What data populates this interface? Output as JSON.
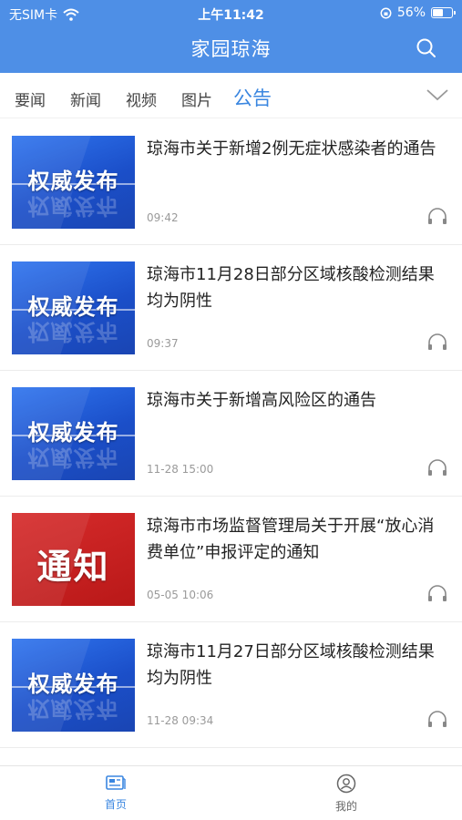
{
  "status_bar": {
    "carrier": "无SIM卡",
    "time": "上午11:42",
    "battery": "56%",
    "battery_level": 0.56
  },
  "header": {
    "title": "家园琼海"
  },
  "tabs": [
    {
      "label": "要闻"
    },
    {
      "label": "新闻"
    },
    {
      "label": "视频"
    },
    {
      "label": "图片"
    },
    {
      "label": "公告",
      "active": true
    }
  ],
  "articles": [
    {
      "title": "琼海市关于新增2例无症状感染者的通告",
      "time": "09:42",
      "thumb_text": "权威发布",
      "thumb_color": "blue"
    },
    {
      "title": "琼海市11月28日部分区域核酸检测结果均为阴性",
      "time": "09:37",
      "thumb_text": "权威发布",
      "thumb_color": "blue"
    },
    {
      "title": "琼海市关于新增高风险区的通告",
      "time": "11-28 15:00",
      "thumb_text": "权威发布",
      "thumb_color": "blue"
    },
    {
      "title": "琼海市市场监督管理局关于开展“放心消费单位”申报评定的通知",
      "time": "05-05 10:06",
      "thumb_text": "通知",
      "thumb_color": "red"
    },
    {
      "title": "琼海市11月27日部分区域核酸检测结果均为阴性",
      "time": "11-28 09:34",
      "thumb_text": "权威发布",
      "thumb_color": "blue"
    }
  ],
  "bottom_nav": {
    "home": "首页",
    "mine": "我的"
  },
  "colors": {
    "header_bg": "#4e8fe6",
    "accent": "#3a86e0"
  }
}
